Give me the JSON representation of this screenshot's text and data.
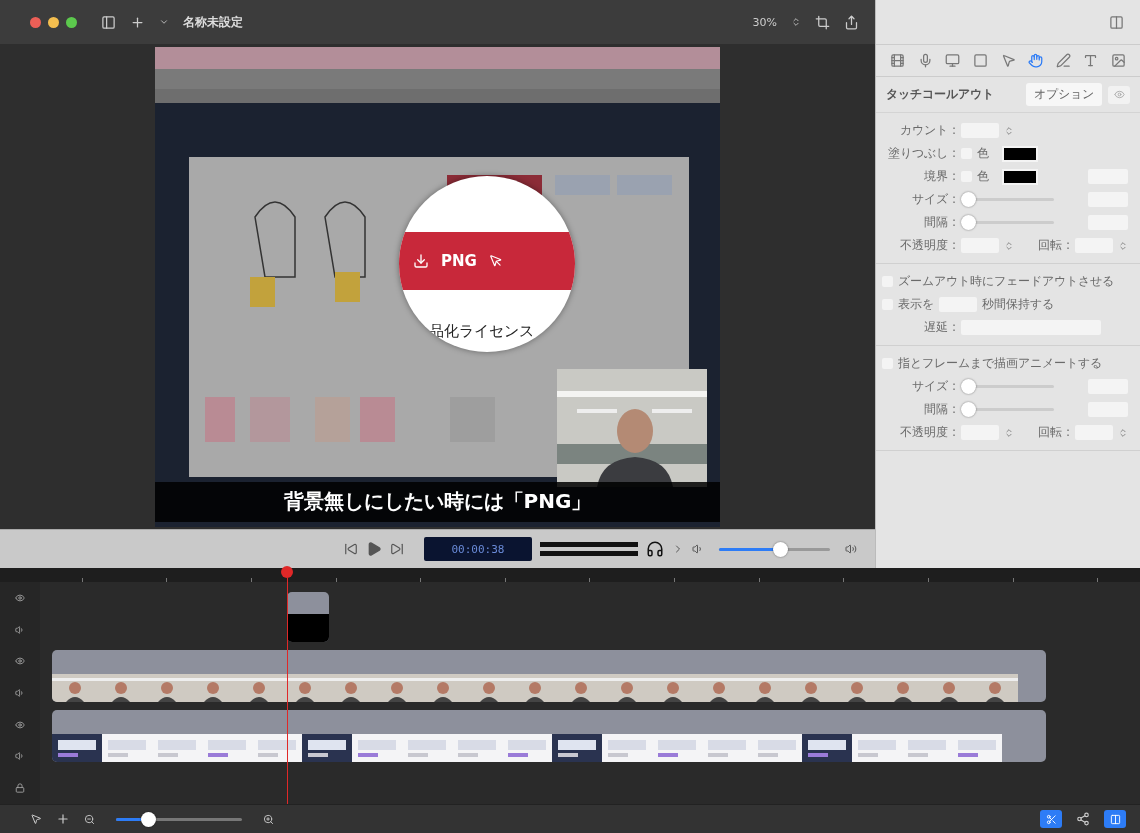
{
  "toolbar": {
    "title": "名称未設定",
    "zoom": "30%"
  },
  "preview": {
    "magnifier_label": "PNG",
    "magnifier_text": "品化ライセンス",
    "caption": "背景無しにしたい時には「PNG」"
  },
  "playback": {
    "timecode": "00:00:38",
    "volume": {
      "level": 0.55
    }
  },
  "inspector": {
    "title": "タッチコールアウト",
    "option_button": "オプション",
    "tools": [
      {
        "kind": "video",
        "selected": false
      },
      {
        "kind": "audio",
        "selected": false
      },
      {
        "kind": "screen",
        "selected": false
      },
      {
        "kind": "callout",
        "selected": false
      },
      {
        "kind": "pointer",
        "selected": false
      },
      {
        "kind": "touch",
        "selected": true
      },
      {
        "kind": "annotation",
        "selected": false
      },
      {
        "kind": "text",
        "selected": false
      },
      {
        "kind": "media",
        "selected": false
      }
    ],
    "sections": [
      {
        "rows": [
          {
            "kind": "stepper",
            "label": "カウント :"
          },
          {
            "kind": "color",
            "label": "塗りつぶし :",
            "check_label": "色",
            "checked": false
          },
          {
            "kind": "colorfield",
            "label": "境界 :",
            "check_label": "色",
            "checked": false
          },
          {
            "kind": "slider",
            "label": "サイズ :",
            "level": 0
          },
          {
            "kind": "slider",
            "label": "間隔 :",
            "level": 0
          },
          {
            "kind": "pair",
            "label": "不透明度 :",
            "label2": "回転 :"
          }
        ]
      },
      {
        "rows": [
          {
            "kind": "check",
            "label": "ズームアウト時にフェードアウトさせる",
            "checked": false
          },
          {
            "kind": "checkfield",
            "label": "表示を",
            "label2": "秒間保持する",
            "checked": false
          },
          {
            "kind": "select",
            "label": "遅延 :"
          }
        ]
      },
      {
        "rows": [
          {
            "kind": "check",
            "label": "指とフレームまで描画アニメートする",
            "checked": false
          },
          {
            "kind": "slider",
            "label": "サイズ :",
            "level": 0
          },
          {
            "kind": "slider",
            "label": "間隔 :",
            "level": 0
          },
          {
            "kind": "pair",
            "label": "不透明度 :",
            "label2": "回転 :"
          }
        ]
      }
    ]
  },
  "timeline": {
    "zoom": {
      "level": 0.25
    },
    "tracks": [
      {
        "kind": "callout"
      },
      {
        "kind": "camera"
      },
      {
        "kind": "screen"
      }
    ]
  }
}
